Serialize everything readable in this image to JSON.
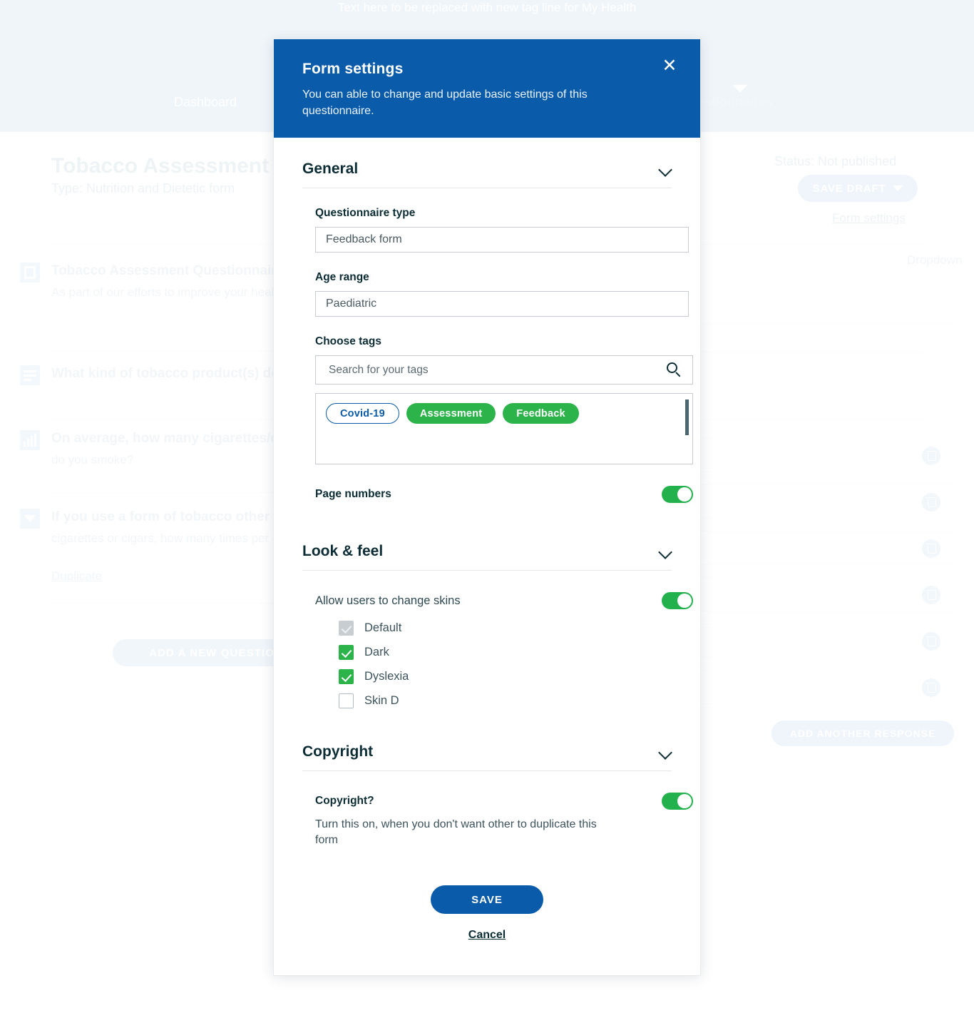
{
  "background": {
    "tagline": "Text here to be replaced with new tag line for My Health",
    "nav": {
      "dashboard": "Dashboard",
      "questionnaires": "& Questionnaires"
    },
    "form_title": "Tobacco Assessment Questionnaire",
    "form_type": "Type:   Nutrition and Dietetic form",
    "status": "Status:  Not published",
    "save_draft": "SAVE DRAFT",
    "form_settings_link": "Form settings",
    "dropdown_label": "Dropdown",
    "questions": [
      {
        "title": "Tobacco Assessment Questionnaire",
        "body": "As part of our efforts to improve your health we are asking all our patients who smoke"
      },
      {
        "title": "What kind of tobacco product(s) do you use?",
        "body": ""
      },
      {
        "title": "On average, how many cigarettes/cigars a day",
        "body": "do you smoke?"
      },
      {
        "title": "If you use a form of tobacco other than",
        "body": "cigarettes or cigars, how many times per day do you use it?"
      }
    ],
    "duplicate_link": "Duplicate",
    "add_question_button": "ADD A NEW QUESTION",
    "add_response_button": "ADD ANOTHER RESPONSE",
    "response_row_count": 6
  },
  "modal": {
    "title": "Form settings",
    "subtitle": "You can able to change and update basic settings of this questionnaire.",
    "close_icon": "close-icon",
    "sections": {
      "general": {
        "heading": "General",
        "questionnaire_type": {
          "label": "Questionnaire type",
          "value": "Feedback form"
        },
        "age_range": {
          "label": "Age range",
          "value": "Paediatric"
        },
        "choose_tags": {
          "label": "Choose tags",
          "search_placeholder": "Search for your tags",
          "search_value": "",
          "tags": [
            {
              "label": "Covid-19",
              "style": "outline"
            },
            {
              "label": "Assessment",
              "style": "solid"
            },
            {
              "label": "Feedback",
              "style": "solid"
            }
          ]
        },
        "page_numbers": {
          "label": "Page numbers",
          "on": true
        }
      },
      "look_and_feel": {
        "heading": "Look & feel",
        "allow_skins": {
          "label": "Allow users to change skins",
          "on": true
        },
        "skins": [
          {
            "label": "Default",
            "state": "disabled-checked"
          },
          {
            "label": "Dark",
            "state": "checked"
          },
          {
            "label": "Dyslexia",
            "state": "checked"
          },
          {
            "label": "Skin D",
            "state": "unchecked"
          }
        ]
      },
      "copyright": {
        "heading": "Copyright",
        "toggle_label": "Copyright?",
        "toggle_on": true,
        "note": "Turn this on, when you don't want other to duplicate this form"
      }
    },
    "actions": {
      "save": "SAVE",
      "cancel": "Cancel"
    }
  },
  "colors": {
    "brand_blue": "#0a5ba9",
    "green": "#2cb34a",
    "toggle_green": "#22b14c",
    "dark_text": "#0c2d35"
  }
}
